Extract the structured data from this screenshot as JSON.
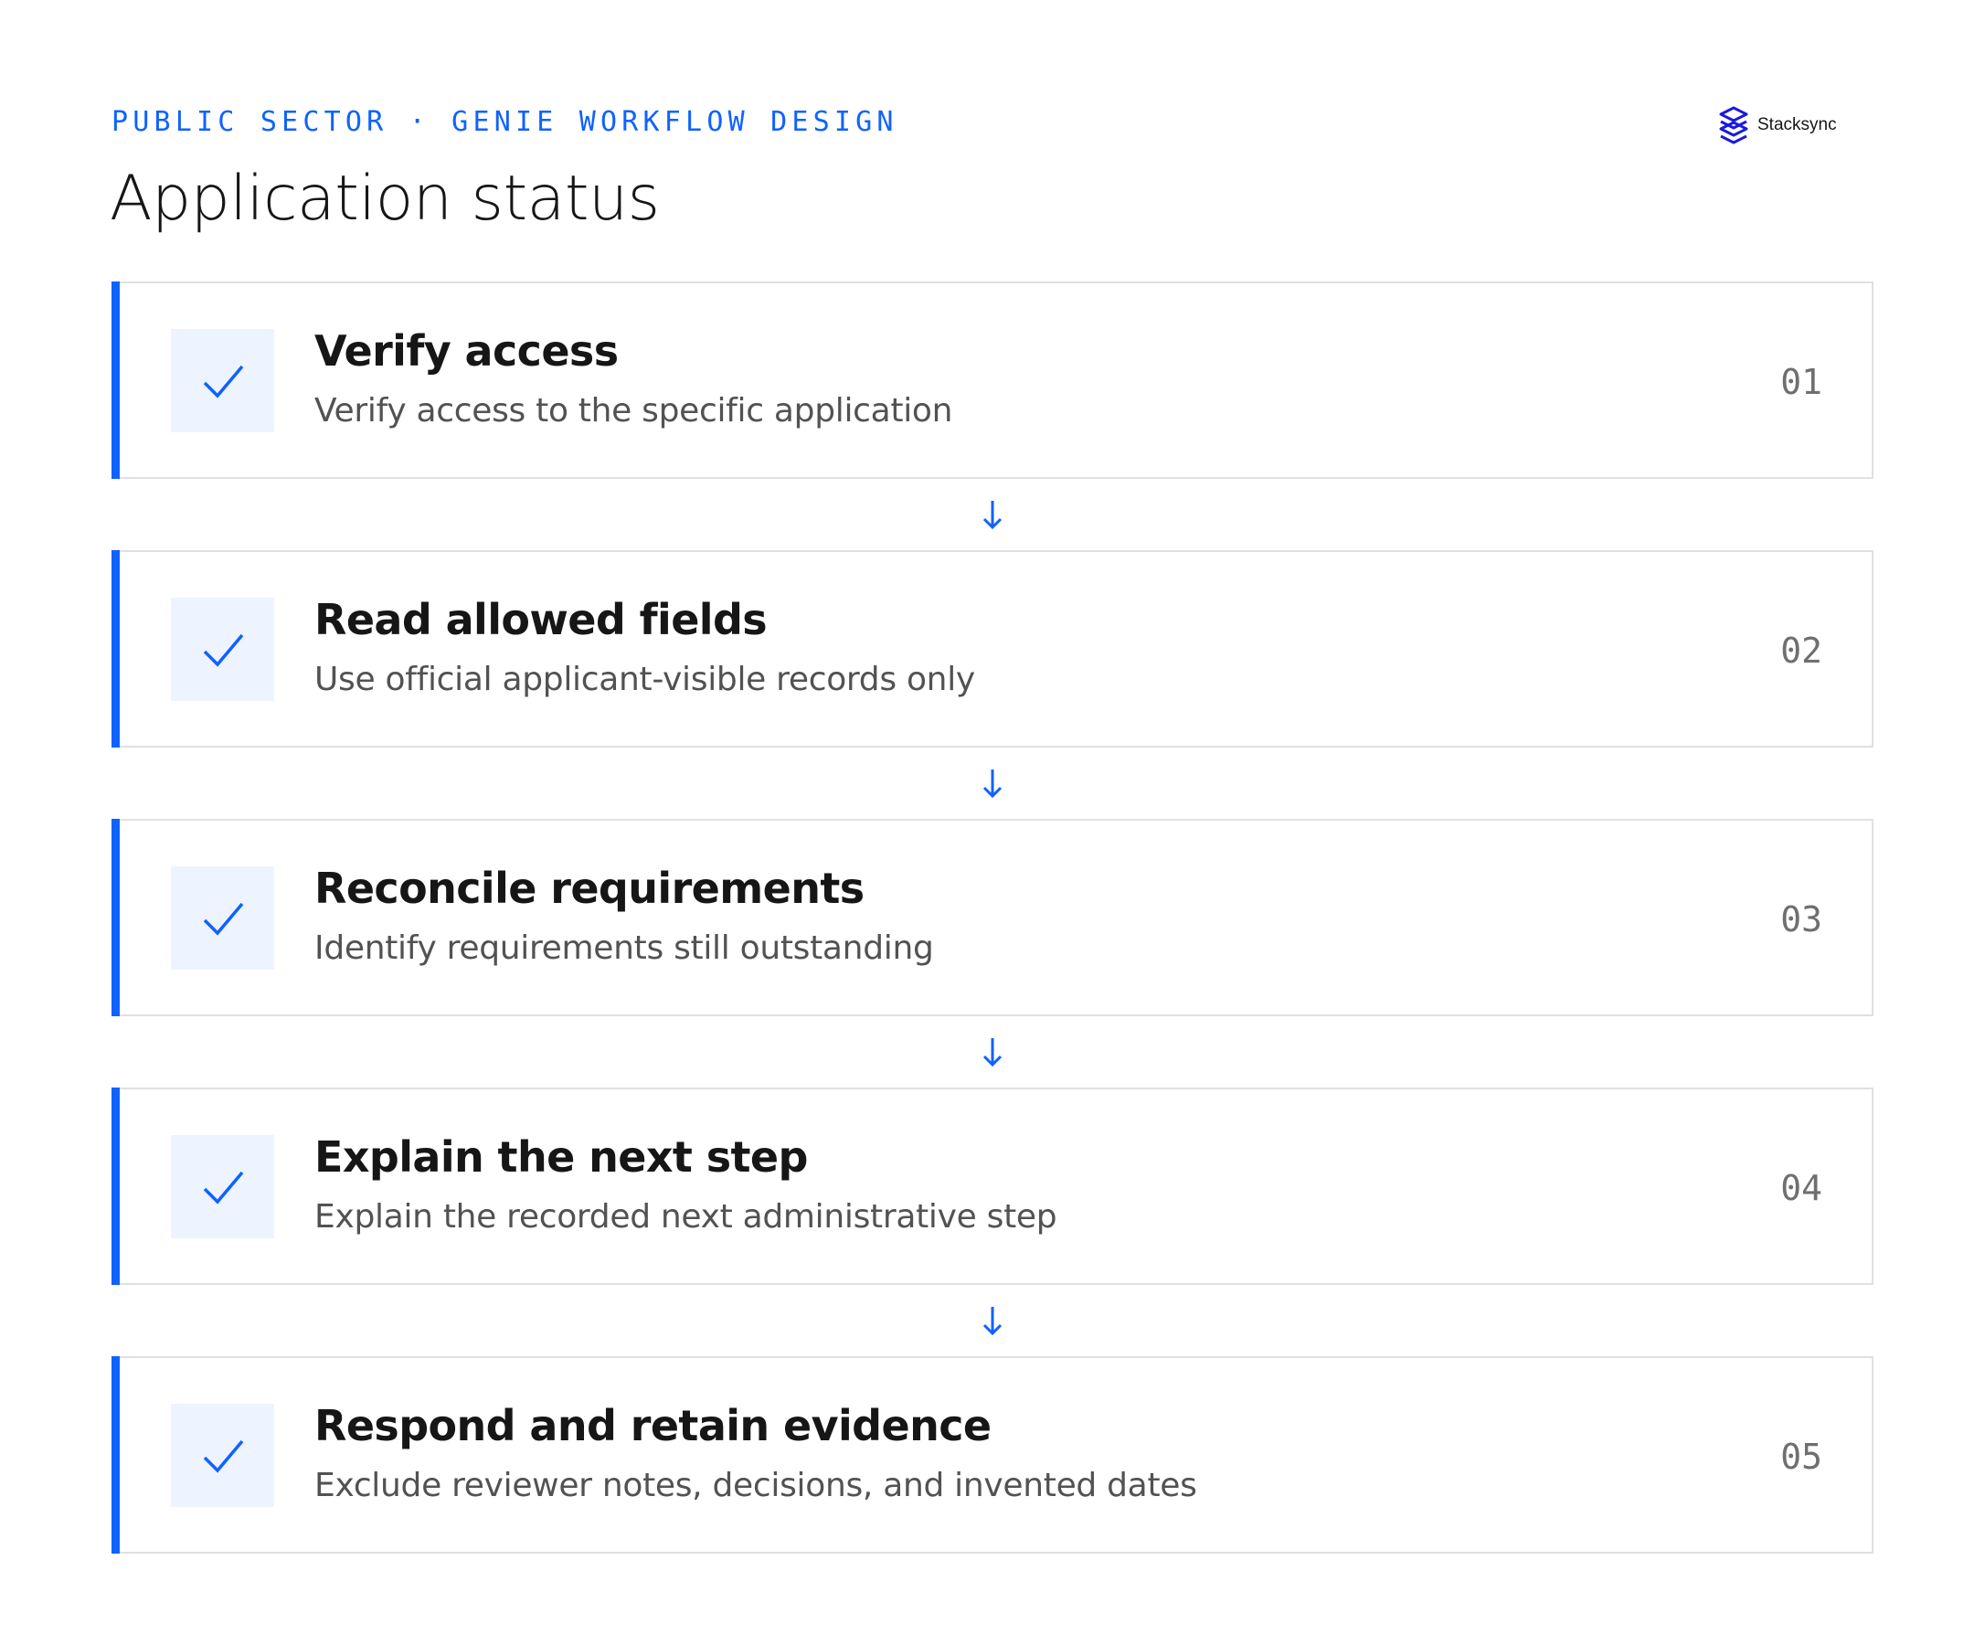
{
  "eyebrow": "PUBLIC SECTOR · GENIE WORKFLOW DESIGN",
  "title": "Application status",
  "logo": {
    "text": "Stacksync",
    "icon": "stacksync-logo-icon",
    "color": "#1a1adb"
  },
  "colors": {
    "accent": "#0f62fe",
    "check_bg": "#edf4ff",
    "border": "#e0e0e0",
    "title_text": "#161616",
    "desc_text": "#525252",
    "number_text": "#6f6f6f"
  },
  "steps": [
    {
      "number": "01",
      "title": "Verify access",
      "description": "Verify access to the specific application",
      "status_icon": "check-icon"
    },
    {
      "number": "02",
      "title": "Read allowed fields",
      "description": "Use official applicant-visible records only",
      "status_icon": "check-icon"
    },
    {
      "number": "03",
      "title": "Reconcile requirements",
      "description": "Identify requirements still outstanding",
      "status_icon": "check-icon"
    },
    {
      "number": "04",
      "title": "Explain the next step",
      "description": "Explain the recorded next administrative step",
      "status_icon": "check-icon"
    },
    {
      "number": "05",
      "title": "Respond and retain evidence",
      "description": "Exclude reviewer notes, decisions, and invented dates",
      "status_icon": "check-icon"
    }
  ],
  "connector_icon": "arrow-down-icon"
}
